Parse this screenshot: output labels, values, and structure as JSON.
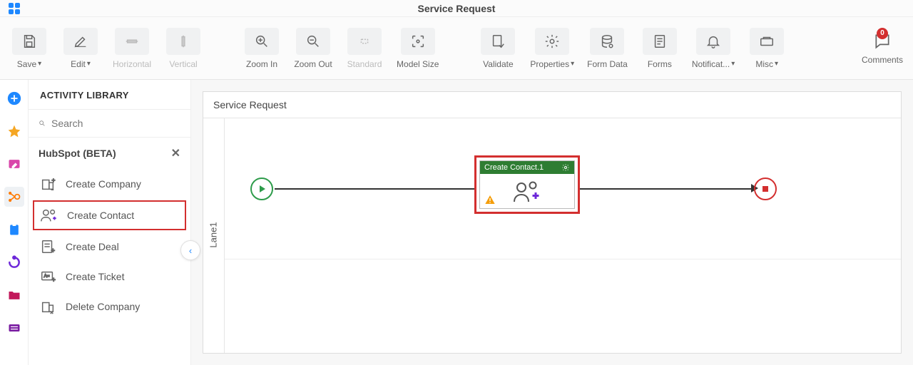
{
  "header": {
    "title": "Service Request"
  },
  "toolbar": {
    "save": "Save",
    "edit": "Edit",
    "horizontal": "Horizontal",
    "vertical": "Vertical",
    "zoom_in": "Zoom In",
    "zoom_out": "Zoom Out",
    "standard": "Standard",
    "model_size": "Model Size",
    "validate": "Validate",
    "properties": "Properties",
    "form_data": "Form Data",
    "forms": "Forms",
    "notifications": "Notificat...",
    "misc": "Misc",
    "comments": "Comments",
    "comments_count": "0"
  },
  "sidebar": {
    "title": "ACTIVITY LIBRARY",
    "search_placeholder": "Search",
    "group": "HubSpot (BETA)",
    "items": [
      {
        "label": "Create Company"
      },
      {
        "label": "Create Contact"
      },
      {
        "label": "Create Deal"
      },
      {
        "label": "Create Ticket"
      },
      {
        "label": "Delete Company"
      }
    ]
  },
  "canvas": {
    "title": "Service Request",
    "lane_label": "Lane1",
    "activity_node": {
      "title": "Create Contact.1"
    }
  }
}
